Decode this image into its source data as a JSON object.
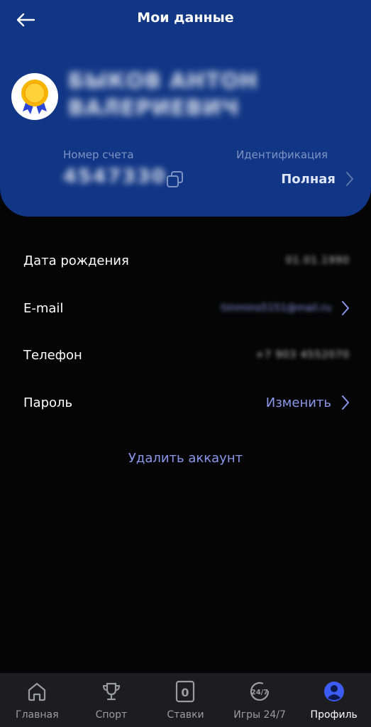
{
  "header": {
    "title": "Мои данные",
    "user_name": "БЫКОВ АНТОН ВАЛЕРИЕВИЧ",
    "account_label": "Номер счета",
    "account_number": "4547330",
    "identification_label": "Идентификация",
    "identification_value": "Полная"
  },
  "details": {
    "birth_label": "Дата рождения",
    "birth_value": "01.01.1990",
    "email_label": "E-mail",
    "email_value": "timmins5151@mail.ru",
    "phone_label": "Телефон",
    "phone_value": "+7 903 4552070",
    "password_label": "Пароль",
    "password_action": "Изменить"
  },
  "delete_account": "Удалить аккаунт",
  "nav": {
    "items": [
      {
        "label": "Главная",
        "icon": "home-icon"
      },
      {
        "label": "Спорт",
        "icon": "trophy-icon"
      },
      {
        "label": "Ставки",
        "icon": "bets-icon",
        "badge": "0"
      },
      {
        "label": "Игры 24/7",
        "icon": "games-24-7-icon",
        "badge": "24/7"
      },
      {
        "label": "Профиль",
        "icon": "profile-icon"
      }
    ],
    "active": "Профиль"
  },
  "colors": {
    "header_bg": "#113685",
    "accent": "#8a97ea",
    "background": "#050505",
    "nav_bg": "#1d1d20"
  }
}
